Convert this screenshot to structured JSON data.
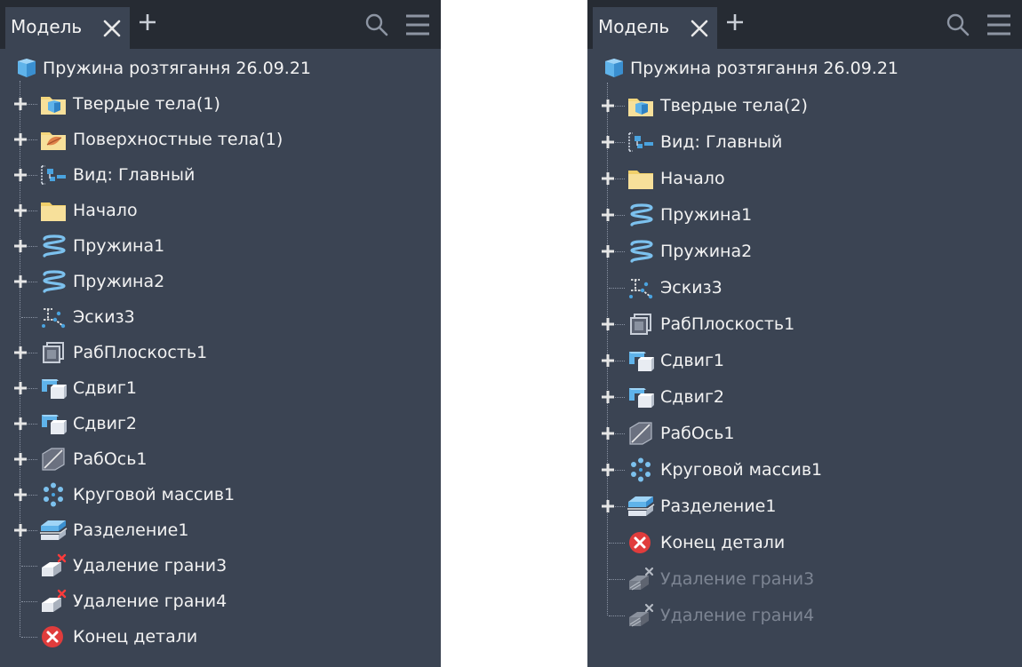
{
  "panels": [
    {
      "id": "left",
      "tab": {
        "label": "Модель"
      },
      "root": {
        "label": "Пружина розтягання 26.09.21",
        "icon": "part-cube-icon"
      },
      "items": [
        {
          "label": "Твердые тела(1)",
          "icon": "solid-bodies-folder-icon",
          "expandable": true,
          "dimmed": false
        },
        {
          "label": "Поверхностные тела(1)",
          "icon": "surface-bodies-folder-icon",
          "expandable": true,
          "dimmed": false
        },
        {
          "label": "Вид: Главный",
          "icon": "view-icon",
          "expandable": true,
          "dimmed": false
        },
        {
          "label": "Начало",
          "icon": "origin-folder-icon",
          "expandable": true,
          "dimmed": false
        },
        {
          "label": "Пружина1",
          "icon": "coil-icon",
          "expandable": true,
          "dimmed": false
        },
        {
          "label": "Пружина2",
          "icon": "coil-icon",
          "expandable": true,
          "dimmed": false
        },
        {
          "label": "Эскиз3",
          "icon": "sketch-icon",
          "expandable": false,
          "dimmed": false
        },
        {
          "label": "РабПлоскость1",
          "icon": "work-plane-icon",
          "expandable": true,
          "dimmed": false
        },
        {
          "label": "Сдвиг1",
          "icon": "sweep-icon",
          "expandable": true,
          "dimmed": false
        },
        {
          "label": "Сдвиг2",
          "icon": "sweep-icon",
          "expandable": true,
          "dimmed": false
        },
        {
          "label": "РабОсь1",
          "icon": "work-axis-icon",
          "expandable": true,
          "dimmed": false
        },
        {
          "label": "Круговой массив1",
          "icon": "circular-pattern-icon",
          "expandable": true,
          "dimmed": false
        },
        {
          "label": "Разделение1",
          "icon": "split-icon",
          "expandable": true,
          "dimmed": false
        },
        {
          "label": "Удаление грани3",
          "icon": "delete-face-icon",
          "expandable": false,
          "dimmed": false
        },
        {
          "label": "Удаление грани4",
          "icon": "delete-face-icon",
          "expandable": false,
          "dimmed": false
        },
        {
          "label": "Конец детали",
          "icon": "end-of-part-icon",
          "expandable": false,
          "dimmed": false
        }
      ]
    },
    {
      "id": "right",
      "tab": {
        "label": "Модель"
      },
      "root": {
        "label": "Пружина розтягання 26.09.21",
        "icon": "part-cube-icon"
      },
      "items": [
        {
          "label": "Твердые тела(2)",
          "icon": "solid-bodies-folder-icon",
          "expandable": true,
          "dimmed": false
        },
        {
          "label": "Вид: Главный",
          "icon": "view-icon",
          "expandable": true,
          "dimmed": false
        },
        {
          "label": "Начало",
          "icon": "origin-folder-icon",
          "expandable": true,
          "dimmed": false
        },
        {
          "label": "Пружина1",
          "icon": "coil-icon",
          "expandable": true,
          "dimmed": false
        },
        {
          "label": "Пружина2",
          "icon": "coil-icon",
          "expandable": true,
          "dimmed": false
        },
        {
          "label": "Эскиз3",
          "icon": "sketch-icon",
          "expandable": false,
          "dimmed": false
        },
        {
          "label": "РабПлоскость1",
          "icon": "work-plane-icon",
          "expandable": true,
          "dimmed": false
        },
        {
          "label": "Сдвиг1",
          "icon": "sweep-icon",
          "expandable": true,
          "dimmed": false
        },
        {
          "label": "Сдвиг2",
          "icon": "sweep-icon",
          "expandable": true,
          "dimmed": false
        },
        {
          "label": "РабОсь1",
          "icon": "work-axis-icon",
          "expandable": true,
          "dimmed": false
        },
        {
          "label": "Круговой массив1",
          "icon": "circular-pattern-icon",
          "expandable": true,
          "dimmed": false
        },
        {
          "label": "Разделение1",
          "icon": "split-icon",
          "expandable": true,
          "dimmed": false
        },
        {
          "label": "Конец детали",
          "icon": "end-of-part-icon",
          "expandable": false,
          "dimmed": false
        },
        {
          "label": "Удаление грани3",
          "icon": "delete-face-suppressed-icon",
          "expandable": false,
          "dimmed": true
        },
        {
          "label": "Удаление грани4",
          "icon": "delete-face-suppressed-icon",
          "expandable": false,
          "dimmed": true
        }
      ]
    }
  ],
  "colors": {
    "panel_bg": "#3b4453",
    "tabbar_bg": "#262b33",
    "text": "#f2f2f2",
    "dim_text": "#7d8593",
    "accent_blue": "#4aa3df",
    "folder_yellow": "#f5d77c",
    "error_red": "#e03c3c"
  }
}
